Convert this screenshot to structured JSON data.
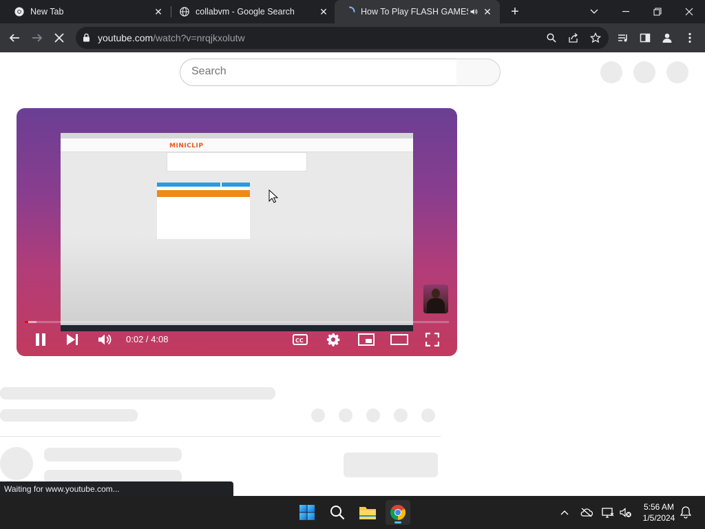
{
  "browser": {
    "tabs": [
      {
        "title": "New Tab",
        "favicon": "chrome-icon",
        "active": false
      },
      {
        "title": "collabvm - Google Search",
        "favicon": "globe-icon",
        "active": false
      },
      {
        "title": "How To Play FLASH GAMES (",
        "favicon": "loading-spinner-icon",
        "active": true,
        "audio": true
      }
    ],
    "omnibox": {
      "host": "youtube.com",
      "path": "/watch?v=nrqjkxolutw"
    },
    "status_text": "Waiting for www.youtube.com..."
  },
  "youtube": {
    "search_placeholder": "Search",
    "player": {
      "time_current": "0:02",
      "time_separator": " / ",
      "time_total": "4:08",
      "progress_played_fraction": 0.008,
      "progress_loaded_fraction": 0.027,
      "screen_logo": "MINICLIP"
    }
  },
  "taskbar": {
    "apps": [
      "start-icon",
      "search-icon",
      "file-explorer-icon",
      "chrome-icon"
    ],
    "time": "5:56 AM",
    "date": "1/5/2024"
  },
  "colors": {
    "youtube_red": "#ff0000",
    "player_gradient_top": "#6a3f94",
    "player_gradient_bottom": "#c23a5e",
    "win_accent": "#4cc2ff"
  }
}
